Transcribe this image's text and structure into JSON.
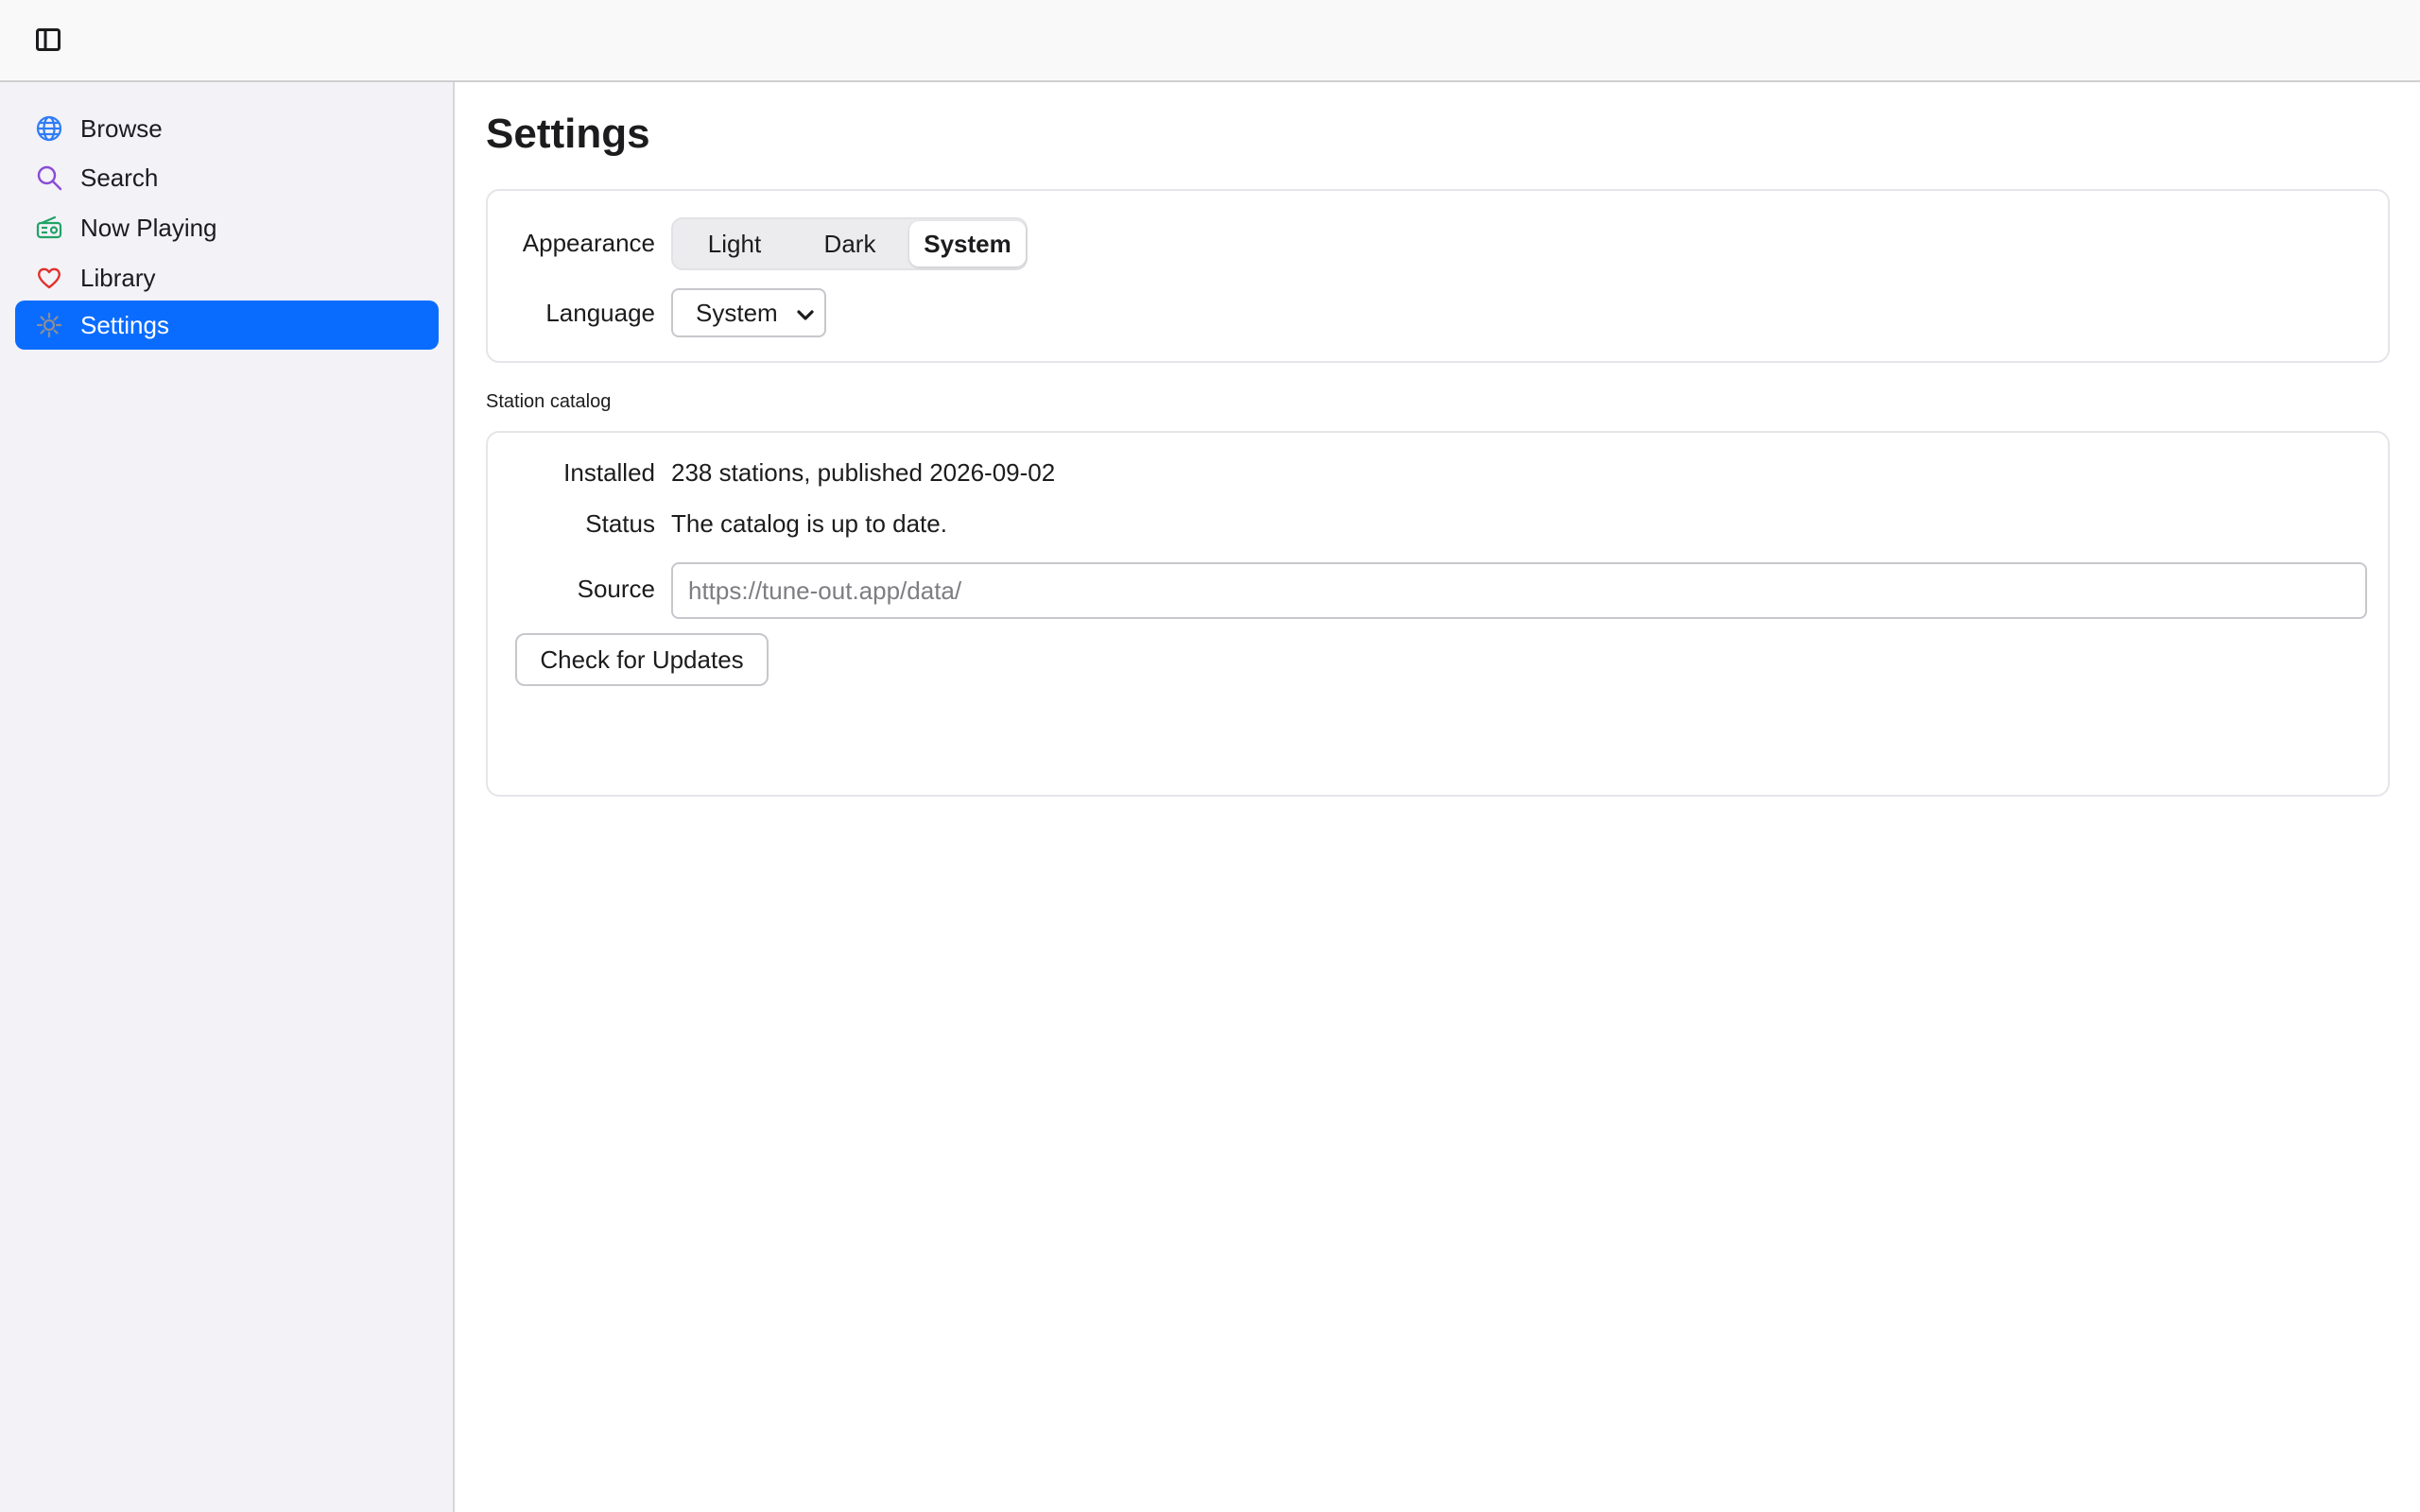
{
  "toolbar": {
    "toggle_icon": "sidebar-toggle-icon"
  },
  "sidebar": {
    "items": [
      {
        "label": "Browse",
        "icon": "globe-icon",
        "icon_color": "#2f7cf6",
        "active": false
      },
      {
        "label": "Search",
        "icon": "search-icon",
        "icon_color": "#8a4bd6",
        "active": false
      },
      {
        "label": "Now Playing",
        "icon": "radio-icon",
        "icon_color": "#21a366",
        "active": false
      },
      {
        "label": "Library",
        "icon": "heart-icon",
        "icon_color": "#e2312b",
        "active": false
      },
      {
        "label": "Settings",
        "icon": "gear-icon",
        "icon_color": "#8e8e93",
        "active": true
      }
    ],
    "active_color": "#0a6cff"
  },
  "main": {
    "title": "Settings",
    "appearance": {
      "label": "Appearance",
      "options": [
        "Light",
        "Dark",
        "System"
      ],
      "selected": "System"
    },
    "language": {
      "label": "Language",
      "value": "System"
    },
    "catalog": {
      "section_label": "Station catalog",
      "installed_label": "Installed",
      "installed_value": "238 stations, published 2026-09-02",
      "status_label": "Status",
      "status_value": "The catalog is up to date.",
      "source_label": "Source",
      "source_placeholder": "https://tune-out.app/data/",
      "check_button": "Check for Updates"
    }
  }
}
